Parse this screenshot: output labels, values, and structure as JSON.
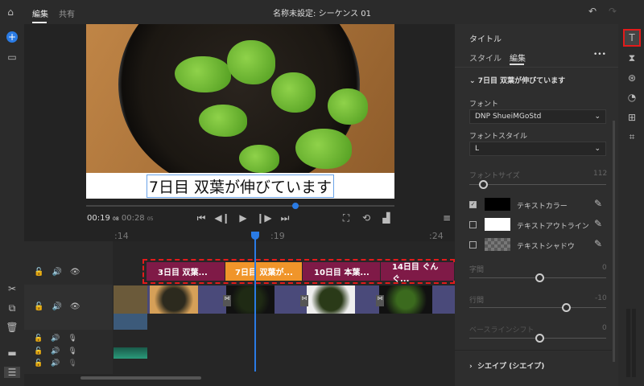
{
  "header": {
    "tabs": [
      {
        "label": "編集"
      },
      {
        "label": "共有"
      }
    ],
    "title": "名称未設定: シーケンス 01"
  },
  "monitor": {
    "caption": "7日目 双葉が伸びています",
    "current_time": "00:19",
    "current_frames": "08",
    "total_time": "00:28",
    "total_frames": "05",
    "playhead_progress": 0.68
  },
  "timeline": {
    "ruler": [
      ":14",
      ":19",
      ":24"
    ],
    "clips": [
      {
        "label": "3日目 双葉..."
      },
      {
        "label": "7日目 双葉が..."
      },
      {
        "label": "10日目 本葉..."
      },
      {
        "label": "14日目 ぐんぐ..."
      }
    ]
  },
  "panel": {
    "title": "タイトル",
    "tabs": [
      {
        "label": "スタイル"
      },
      {
        "label": "編集"
      }
    ],
    "more": "•••",
    "section": "7日目 双葉が伸びています",
    "font_label": "フォント",
    "font_value": "DNP ShueiMGoStd",
    "style_label": "フォントスタイル",
    "style_value": "L",
    "size_label": "フォントサイズ",
    "size_value": "112",
    "colors": [
      {
        "label": "テキストカラー",
        "checked": true,
        "color": "#000000"
      },
      {
        "label": "テキストアウトライン",
        "checked": false,
        "color": "#ffffff"
      },
      {
        "label": "テキストシャドウ",
        "checked": false,
        "color": "#777777"
      }
    ],
    "tracking_label": "字間",
    "tracking_value": "0",
    "leading_label": "行間",
    "leading_value": "-10",
    "baseline_label": "ベースラインシフト",
    "baseline_value": "0",
    "shape_section": "シエイプ (シエイプ)"
  }
}
